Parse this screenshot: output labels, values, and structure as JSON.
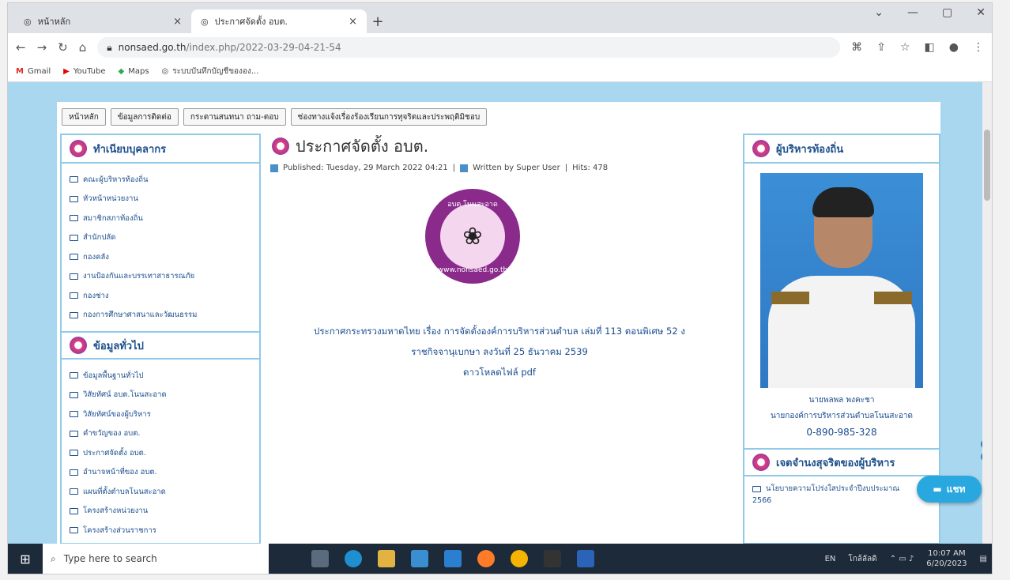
{
  "browser": {
    "tabs": [
      {
        "title": "หน้าหลัก",
        "close": "×"
      },
      {
        "title": "ประกาศจัดตั้ง อบต.",
        "close": "×"
      }
    ],
    "new_tab": "+",
    "url_host": "nonsaed.go.th",
    "url_path": "/index.php/2022-03-29-04-21-54",
    "bookmarks": [
      "Gmail",
      "YouTube",
      "Maps",
      "ระบบบันทึกบัญชีขององ..."
    ]
  },
  "nav": {
    "menu": [
      "หน้าหลัก",
      "ข้อมูลการติดต่อ",
      "กระดานสนทนา ถาม-ตอบ",
      "ช่องทางแจ้งเรื่องร้องเรียนการทุจริตและประพฤติมิชอบ"
    ]
  },
  "left": {
    "personnel_title": "ทำเนียบบุคลากร",
    "personnel": [
      "คณะผู้บริหารท้องถิ่น",
      "หัวหน้าหน่วยงาน",
      "สมาชิกสภาท้องถิ่น",
      "สำนักปลัด",
      "กองคลัง",
      "งานป้องกันและบรรเทาสาธารณภัย",
      "กองช่าง",
      "กองการศึกษาศาสนาและวัฒนธรรม"
    ],
    "general_title": "ข้อมูลทั่วไป",
    "general": [
      "ข้อมูลพื้นฐานทั่วไป",
      "วิสัยทัศน์ อบต.โนนสะอาด",
      "วิสัยทัศน์ของผู้บริหาร",
      "คำขวัญของ อบต.",
      "ประกาศจัดตั้ง อบต.",
      "อำนาจหน้าที่ของ อบต.",
      "แผนที่ตั้งตำบลโนนสะอาด",
      "โครงสร้างหน่วยงาน",
      "โครงสร้างส่วนราชการ"
    ]
  },
  "article": {
    "title": "ประกาศจัดตั้ง อบต.",
    "published": "Published: Tuesday, 29 March 2022 04:21",
    "author": "Written by Super User",
    "hits": "Hits: 478",
    "seal_top": "อบต.โนนสะอาด",
    "seal_bottom": "www.nonsaed.go.th",
    "line1": "ประกาศกระทรวงมหาดไทย เรื่อง การจัดตั้งองค์การบริหารส่วนตำบล เล่มที่ 113 ตอนพิเศษ 52 ง",
    "line2": "ราชกิจจานุเบกษา ลงวันที่ 25 ธันวาคม 2539",
    "download": "ดาวโหลดไฟล์ pdf"
  },
  "right": {
    "title": "ผู้บริหารท้องถิ่น",
    "name": "นายพลพล พงคะชา",
    "position": "นายกองค์การบริหารส่วนตำบลโนนสะอาด",
    "phone": "0-890-985-328",
    "assets_title": "เจตจำนงสุจริตของผู้บริหาร",
    "assets_item": "นโยบายความโปร่งใสประจำปีงบประมาณ",
    "assets_year": "2566"
  },
  "chat": {
    "label": "แชท"
  },
  "taskbar": {
    "search_placeholder": "Type here to search",
    "lang": "EN",
    "weather": "โกล้ลัลดิ",
    "time": "10:07 AM",
    "date": "6/20/2023"
  },
  "colors": {
    "accent": "#1a4c8f",
    "page_bg": "#a9d7ef",
    "border": "#8fcbe8",
    "seal": "#8a2b8c",
    "chat": "#29a8e0"
  }
}
